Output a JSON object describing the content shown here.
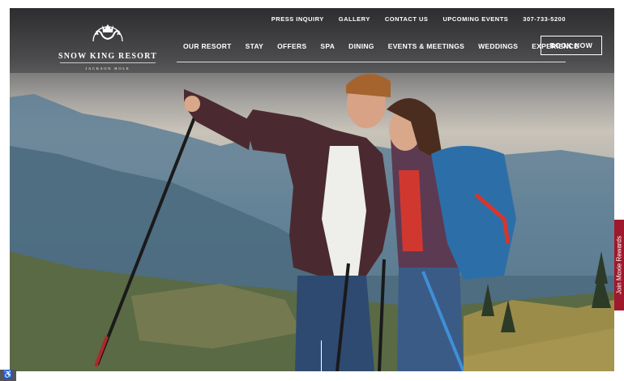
{
  "brand": {
    "name": "SNOW KING RESORT",
    "location": "JACKSON HOLE",
    "emblem": "crown-antlers-emblem"
  },
  "top_nav": [
    "PRESS INQUIRY",
    "GALLERY",
    "CONTACT US",
    "UPCOMING EVENTS",
    "307-733-5200"
  ],
  "main_nav": [
    "OUR RESORT",
    "STAY",
    "OFFERS",
    "SPA",
    "DINING",
    "EVENTS & MEETINGS",
    "WEDDINGS",
    "EXPERIENCE"
  ],
  "cta": {
    "book_now": "BOOK NOW"
  },
  "rewards_tab": {
    "label": "Join Moxie Rewards",
    "icon": "gift-icon",
    "color": "#a0182b"
  },
  "accessibility": {
    "icon": "accessibility-icon"
  },
  "hero": {
    "image": "Hikers with trekking poles on a mountain meadow",
    "icon": "hero-photo"
  }
}
